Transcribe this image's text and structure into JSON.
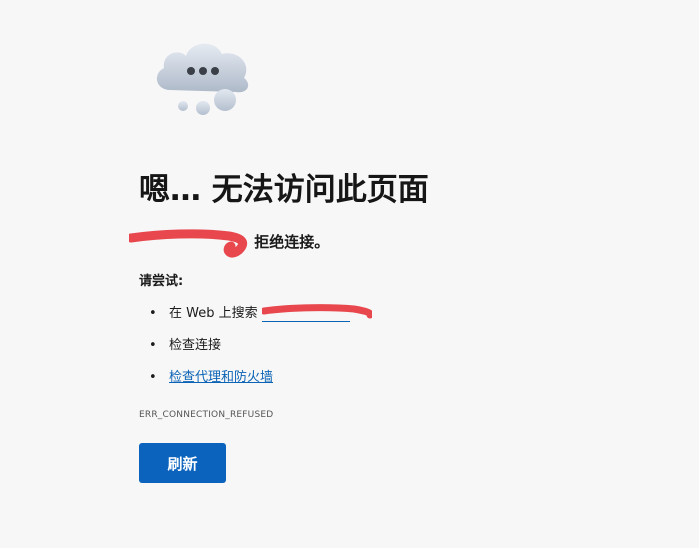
{
  "error_page": {
    "title": "嗯… 无法访问此页面",
    "refused_suffix": "拒绝连接。",
    "try_label": "请尝试:",
    "suggestions": {
      "search_prefix": "在 Web 上搜索",
      "check_connection": "检查连接",
      "check_proxy_firewall": "检查代理和防火墙"
    },
    "error_code": "ERR_CONNECTION_REFUSED",
    "refresh_label": "刷新"
  },
  "colors": {
    "accent": "#0b63bd",
    "link": "#0b63b5",
    "redaction": "#e8484d"
  },
  "icons": {
    "hero": "cloud-ellipsis-icon"
  }
}
